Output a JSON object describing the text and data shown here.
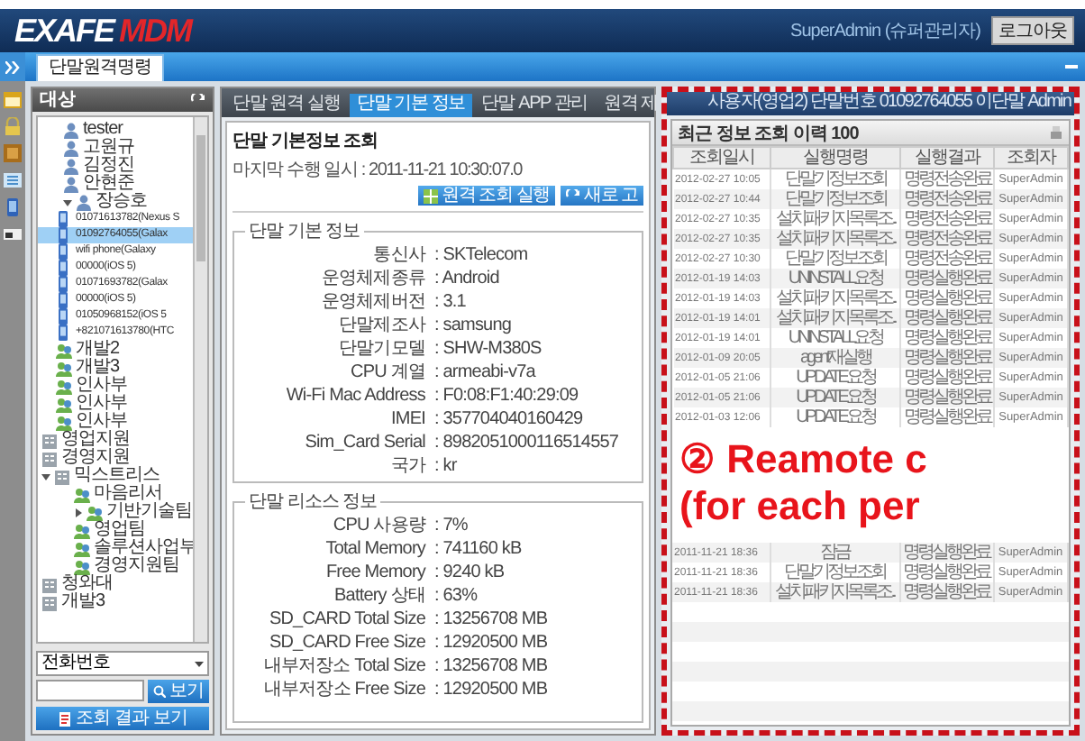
{
  "header": {
    "logo": {
      "text": "EXAFE",
      "accent": "MDM"
    },
    "user": "SuperAdmin (슈퍼관리자)",
    "logout": "로그아웃"
  },
  "page_tabs": [
    {
      "label": "단말원격명령",
      "selected": true
    }
  ],
  "target_panel": {
    "title": "대상",
    "tree": [
      {
        "label": "tester",
        "kind": "person",
        "selected": false
      },
      {
        "label": "고원규",
        "kind": "person",
        "selected": false
      },
      {
        "label": "김정진",
        "kind": "person",
        "selected": false
      },
      {
        "label": "안현준",
        "kind": "person",
        "selected": false
      },
      {
        "label": "장승호",
        "kind": "person",
        "selected": false,
        "expanded": true,
        "children": [
          {
            "label": "01071613782(Nexus S",
            "kind": "device",
            "selected": false
          },
          {
            "label": "01092764055(Galax",
            "kind": "device",
            "selected": true
          },
          {
            "label": "wifi phone(Galaxy",
            "kind": "device",
            "selected": false
          },
          {
            "label": "00000(iOS 5)",
            "kind": "device",
            "selected": false
          },
          {
            "label": "01071693782(Galax",
            "kind": "device",
            "selected": false
          },
          {
            "label": "00000(iOS 5)",
            "kind": "device",
            "selected": false
          },
          {
            "label": "01050968152(iOS 5",
            "kind": "device",
            "selected": false
          },
          {
            "label": "+821071613780(HTC",
            "kind": "device",
            "selected": false
          }
        ]
      },
      {
        "label": "개발2",
        "kind": "team",
        "selected": false
      },
      {
        "label": "개발3",
        "kind": "team",
        "selected": false
      },
      {
        "label": "인사부",
        "kind": "team",
        "selected": false
      },
      {
        "label": "인사부",
        "kind": "team",
        "selected": false
      },
      {
        "label": "인사부",
        "kind": "team",
        "selected": false
      },
      {
        "label": "영업지원",
        "kind": "org",
        "selected": false
      },
      {
        "label": "경영지원",
        "kind": "org",
        "selected": false
      },
      {
        "label": "믹스트리스",
        "kind": "org",
        "selected": false,
        "expanded": true,
        "children": [
          {
            "label": "마음리서",
            "kind": "team",
            "selected": false
          },
          {
            "label": "기반기술팀",
            "kind": "team",
            "selected": false,
            "expanded": false
          },
          {
            "label": "영업팀",
            "kind": "team",
            "selected": false
          },
          {
            "label": "솔루션사업부",
            "kind": "team",
            "selected": false
          },
          {
            "label": "경영지원팀",
            "kind": "team",
            "selected": false
          }
        ]
      },
      {
        "label": "청와대",
        "kind": "org",
        "selected": false
      },
      {
        "label": "개발3",
        "kind": "org",
        "selected": false
      }
    ],
    "search_type": "전화번호",
    "search_button": "보기",
    "results_button": "조회 결과 보기"
  },
  "detail": {
    "tabs": [
      {
        "label": "단말 원격 실행",
        "selected": false
      },
      {
        "label": "단말 기본 정보",
        "selected": true
      },
      {
        "label": "단말 APP 관리",
        "selected": false
      },
      {
        "label": "원격 제",
        "selected": false
      }
    ],
    "title": "단말 기본정보 조회",
    "last_run": "마지막 수행 일시 : 2011-11-21 10:30:07.0",
    "buttons": [
      {
        "label": "원격 조회 실행",
        "kind": "run"
      },
      {
        "label": "새로 고",
        "kind": "refresh"
      }
    ],
    "sections": [
      {
        "title": "단말 기본 정보",
        "rows": [
          {
            "label": "통신사",
            "value": ": SKTelecom"
          },
          {
            "label": "운영체제종류",
            "value": ": Android"
          },
          {
            "label": "운영체제버전",
            "value": ": 3.1"
          },
          {
            "label": "단말제조사",
            "value": ": samsung"
          },
          {
            "label": "단말기모델",
            "value": ": SHW-M380S"
          },
          {
            "label": "CPU 계열",
            "value": ": armeabi-v7a"
          },
          {
            "label": "Wi-Fi Mac Address",
            "value": ": F0:08:F1:40:29:09"
          },
          {
            "label": "IMEI",
            "value": ": 357704040160429"
          },
          {
            "label": "Sim_Card Serial",
            "value": ": 8982051000116514557"
          },
          {
            "label": "국가",
            "value": ": kr"
          }
        ]
      },
      {
        "title": "단말 리소스 정보",
        "rows": [
          {
            "label": "CPU 사용량",
            "value": ": 7%"
          },
          {
            "label": "Total Memory",
            "value": ": 741160 kB"
          },
          {
            "label": "Free Memory",
            "value": ": 9240 kB"
          },
          {
            "label": "Battery 상태",
            "value": ": 63%"
          },
          {
            "label": "SD_CARD Total Size",
            "value": ": 13256708 MB"
          },
          {
            "label": "SD_CARD Free Size",
            "value": ": 12920500 MB"
          },
          {
            "label": "내부저장소 Total Size",
            "value": ": 13256708 MB"
          },
          {
            "label": "내부저장소 Free Size",
            "value": ": 12920500 MB"
          }
        ]
      }
    ]
  },
  "history": {
    "info": "사용자(영업2) 단말번호 01092764055 이단말 Admin",
    "title": "최근 정보 조회 이력 100",
    "columns": [
      "조회일시",
      "실행명령",
      "실행결과",
      "조회자"
    ],
    "rows": [
      [
        "2012-02-27 10:05",
        "단말기정보조회",
        "명령전송완료",
        "SuperAdmin"
      ],
      [
        "2012-02-27 10:44",
        "단말기정보조회",
        "명령전송완료",
        "SuperAdmin"
      ],
      [
        "2012-02-27 10:35",
        "설치패키지목록조..",
        "명령전송완료",
        "SuperAdmin"
      ],
      [
        "2012-02-27 10:35",
        "설치패키지목록조..",
        "명령전송완료",
        "SuperAdmin"
      ],
      [
        "2012-02-27 10:30",
        "단말기정보조회",
        "명령전송완료",
        "SuperAdmin"
      ],
      [
        "2012-01-19 14:03",
        "UNINSTALL요청",
        "명령실행완료",
        "SuperAdmin"
      ],
      [
        "2012-01-19 14:03",
        "설치패키지목록조..",
        "명령실행완료",
        "SuperAdmin"
      ],
      [
        "2012-01-19 14:01",
        "설치패키지목록조..",
        "명령실행완료",
        "SuperAdmin"
      ],
      [
        "2012-01-19 14:01",
        "UNINSTALL요청",
        "명령실행완료",
        "SuperAdmin"
      ],
      [
        "2012-01-09 20:05",
        "agent재실행",
        "명령실행완료",
        "SuperAdmin"
      ],
      [
        "2012-01-05 21:06",
        "UPDATE요청",
        "명령실행완료",
        "SuperAdmin"
      ],
      [
        "2012-01-05 21:06",
        "UPDATE요청",
        "명령실행완료",
        "SuperAdmin"
      ],
      [
        "2012-01-03 12:06",
        "UPDATE요청",
        "명령실행완료",
        "SuperAdmin"
      ]
    ],
    "annotation": [
      "② Reamote c",
      "(for each per"
    ],
    "rows_after": [
      [
        "2011-11-21 18:36",
        "잠금",
        "명령실행완료",
        "SuperAdmin"
      ],
      [
        "2011-11-21 18:36",
        "단말기정보조회",
        "명령실행완료",
        "SuperAdmin"
      ],
      [
        "2011-11-21 18:36",
        "설치패키지목록조..",
        "명령실행완료",
        "SuperAdmin"
      ]
    ]
  }
}
